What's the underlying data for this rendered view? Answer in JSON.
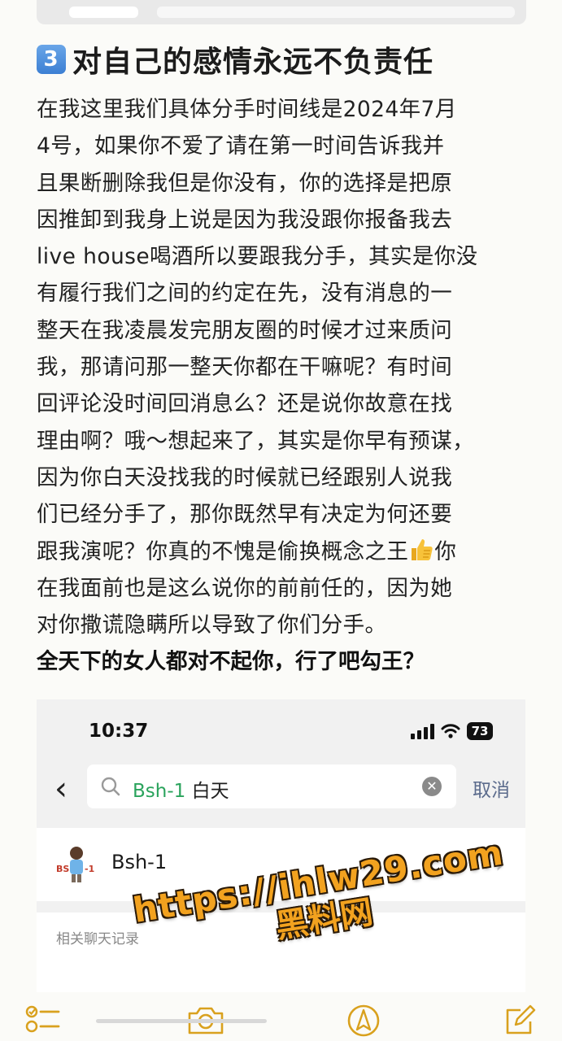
{
  "note": {
    "heading_number": "3",
    "heading": "对自己的感情永远不负责任",
    "paragraph_a": "在我这里我们具体分手时间线是2024年7月\n4号，如果你不爱了请在第一时间告诉我并\n且果断删除我但是你没有，你的选择是把原\n因推卸到我身上说是因为我没跟你报备我去\nlive house喝酒所以要跟我分手，其实是你没\n有履行我们之间的约定在先，没有消息的一\n整天在我凌晨发完朋友圈的时候才过来质问\n我，那请问那一整天你都在干嘛呢？有时间\n回评论没时间回消息么？还是说你故意在找\n理由啊？哦～想起来了，其实是你早有预谋，\n因为你白天没找我的时候就已经跟别人说我\n们已经分手了，那你既然早有决定为何还要\n跟我演呢？你真的不愧是偷换概念之王",
    "paragraph_b": "你\n在我面前也是这么说你的前前任的，因为她\n对你撒谎隐瞒所以导致了你们分手。",
    "bold_line": "全天下的女人都对不起你，行了吧勾王？"
  },
  "screenshot": {
    "time": "10:37",
    "battery": "73",
    "search_highlight": "Bsh-1",
    "search_rest": " 白天",
    "cancel": "取消",
    "contact_name": "Bsh-1",
    "avatar_text": "BSH-1",
    "section_title": "相关聊天记录"
  },
  "watermark": {
    "url": "https://ihlw29.com",
    "name": "黑料网"
  },
  "colors": {
    "accent_green": "#2aa35c",
    "toolbar_gold": "#d9a11e",
    "watermark_orange": "#f2a21f"
  },
  "toolbar": {
    "icons": [
      "checklist-icon",
      "camera-icon",
      "compass-icon",
      "compose-icon"
    ]
  }
}
